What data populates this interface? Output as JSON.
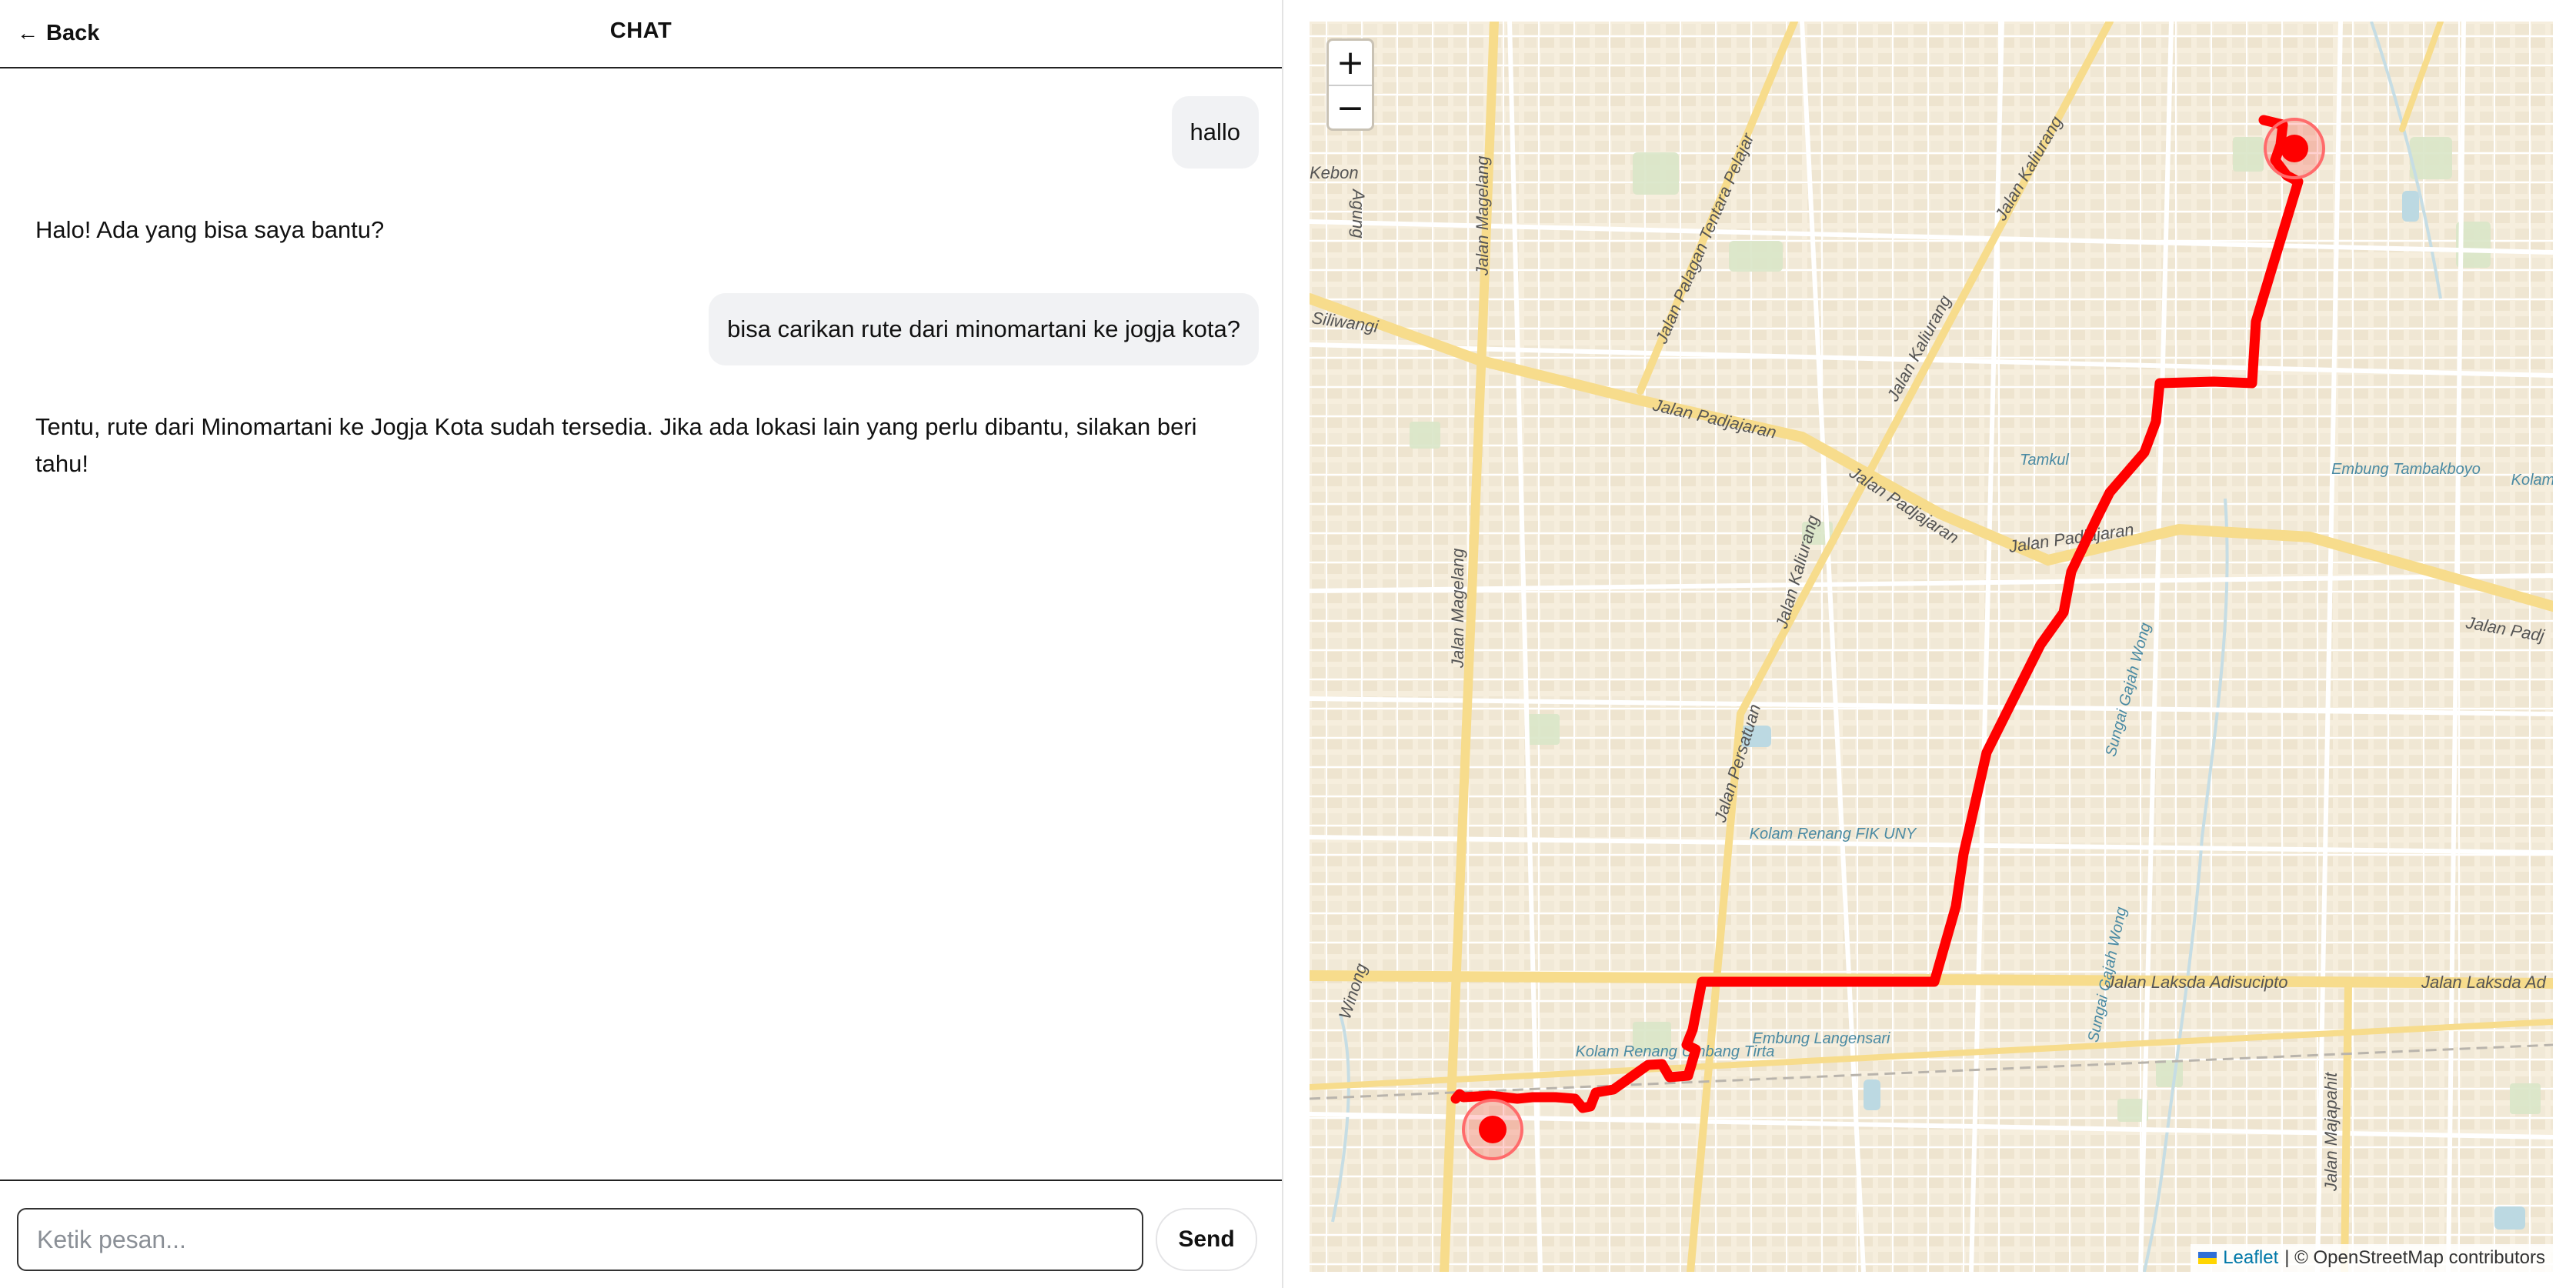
{
  "header": {
    "back_label": "Back",
    "title": "CHAT"
  },
  "messages": [
    {
      "role": "user",
      "text": "hallo"
    },
    {
      "role": "assistant",
      "text": "Halo! Ada yang bisa saya bantu?"
    },
    {
      "role": "user",
      "text": "bisa carikan rute dari minomartani ke jogja kota?"
    },
    {
      "role": "assistant",
      "text": "Tentu, rute dari Minomartani ke Jogja Kota sudah tersedia. Jika ada lokasi lain yang perlu dibantu, silakan beri tahu!"
    }
  ],
  "input": {
    "placeholder": "Ketik pesan...",
    "value": "",
    "send_label": "Send"
  },
  "map": {
    "zoom_in": "+",
    "zoom_out": "−",
    "attribution": {
      "leaflet": "Leaflet",
      "rest": "| © OpenStreetMap contributors"
    },
    "route_color": "#ff0000",
    "labels": {
      "jalan_magelang_top": "Jalan Magelang",
      "jalan_magelang_mid": "Jalan Magelang",
      "jalan_palagan": "Jalan Palagan Tentara Pelajar",
      "jalan_kaliurang_top": "Jalan Kaliurang",
      "jalan_kaliurang_mid": "Jalan Kaliurang",
      "jalan_kaliurang_low": "Jalan Kaliurang",
      "jalan_padjajaran_1": "Jalan Padjajaran",
      "jalan_padjajaran_2": "Jalan Padjajaran",
      "jalan_padjajaran_3": "Jalan Padjajaran",
      "jalan_padj_right": "Jalan Padj",
      "jalan_persatuan": "Jalan Persatuan",
      "jalan_laksda": "Jalan Laksda Adisucipto",
      "jalan_laksda_right": "Jalan Laksda Ad",
      "jalan_majapahit": "Jalan Majapahit",
      "siliwangi": "Siliwangi",
      "kebon": "Kebon",
      "agung": "Agung",
      "winong": "Winong",
      "tamkul": "Tamkul",
      "embung_tambakboyo": "Embung Tambakboyo",
      "kolam_right": "Kolam",
      "kolam_renang_fik": "Kolam Renang FIK UNY",
      "kolam_renang_umbang": "Kolam Renang Umbang Tirta",
      "embung_langensari": "Embung Langensari",
      "sungai_gajah_wong_1": "Sungai Gajah Wong",
      "sungai_gajah_wong_2": "Sungai Gajah Wong"
    }
  }
}
